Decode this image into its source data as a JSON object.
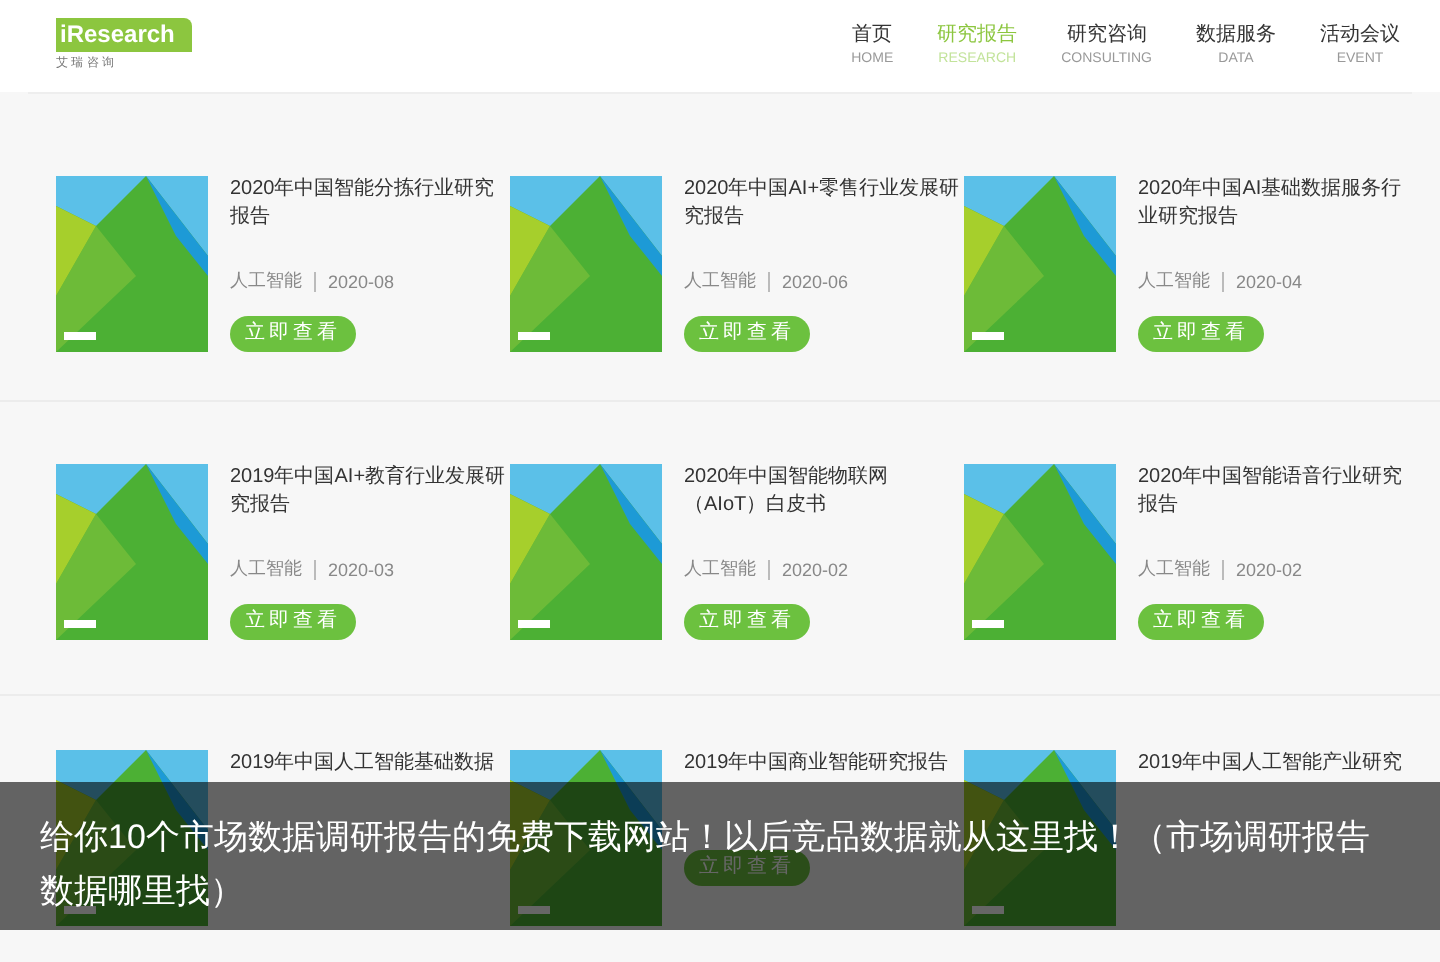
{
  "logo": {
    "name": "iResearch",
    "tagline": "艾 瑞 咨 询"
  },
  "nav": [
    {
      "label": "首页",
      "sub": "HOME",
      "selected": false
    },
    {
      "label": "研究报告",
      "sub": "RESEARCH",
      "selected": true
    },
    {
      "label": "研究咨询",
      "sub": "CONSULTING",
      "selected": false
    },
    {
      "label": "数据服务",
      "sub": "DATA",
      "selected": false
    },
    {
      "label": "活动会议",
      "sub": "EVENT",
      "selected": false
    }
  ],
  "rows": [
    [
      {
        "title": "2020年中国智能分拣行业研究报告",
        "category": "人工智能",
        "date": "2020-08",
        "button": "立即查看"
      },
      {
        "title": "2020年中国AI+零售行业发展研究报告",
        "category": "人工智能",
        "date": "2020-06",
        "button": "立即查看"
      },
      {
        "title": "2020年中国AI基础数据服务行业研究报告",
        "category": "人工智能",
        "date": "2020-04",
        "button": "立即查看"
      }
    ],
    [
      {
        "title": "2019年中国AI+教育行业发展研究报告",
        "category": "人工智能",
        "date": "2020-03",
        "button": "立即查看"
      },
      {
        "title": "2020年中国智能物联网（AIoT）白皮书",
        "category": "人工智能",
        "date": "2020-02",
        "button": "立即查看"
      },
      {
        "title": "2020年中国智能语音行业研究报告",
        "category": "人工智能",
        "date": "2020-02",
        "button": "立即查看"
      }
    ],
    [
      {
        "title": "2019年中国人工智能基础数据"
      },
      {
        "title": "2019年中国商业智能研究报告",
        "button": "立即查看"
      },
      {
        "title": "2019年中国人工智能产业研究"
      }
    ]
  ],
  "caption": "给你10个市场数据调研报告的免费下载网站！以后竞品数据就从这里找！（市场调研报告数据哪里找）"
}
